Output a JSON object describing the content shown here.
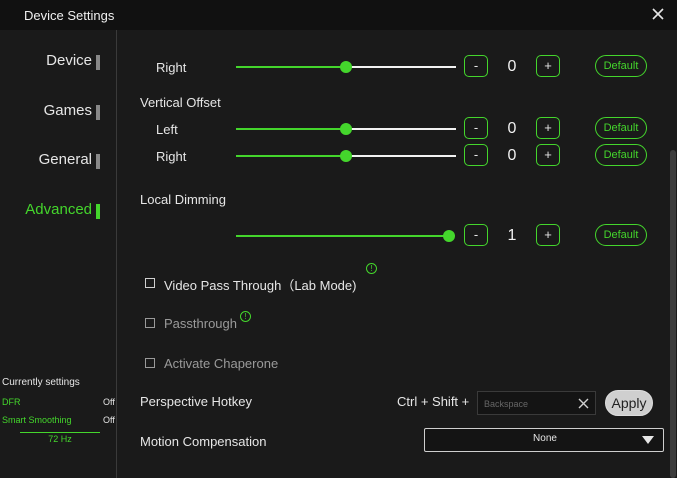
{
  "window": {
    "title": "Device Settings"
  },
  "sidebar": {
    "items": [
      {
        "label": "Device",
        "active": false
      },
      {
        "label": "Games",
        "active": false
      },
      {
        "label": "General",
        "active": false
      },
      {
        "label": "Advanced",
        "active": true
      }
    ]
  },
  "horizontal_offset": {
    "right": {
      "label": "Right",
      "value": "0",
      "level_percent": 50,
      "minus": "-",
      "plus": "+",
      "default_label": "Default"
    }
  },
  "vertical_offset": {
    "heading": "Vertical Offset",
    "left": {
      "label": "Left",
      "value": "0",
      "level_percent": 50,
      "minus": "-",
      "plus": "+",
      "default_label": "Default"
    },
    "right": {
      "label": "Right",
      "value": "0",
      "level_percent": 50,
      "minus": "-",
      "plus": "+",
      "default_label": "Default"
    }
  },
  "local_dimming": {
    "heading": "Local Dimming",
    "value": "1",
    "level_percent": 100,
    "minus": "-",
    "plus": "+",
    "default_label": "Default"
  },
  "options": {
    "video_pass_through": {
      "label": "Video Pass Through（Lab Mode)",
      "checked": false,
      "info": "!"
    },
    "passthrough": {
      "label": "Passthrough",
      "checked": false,
      "enabled": false,
      "info": "!"
    },
    "chaperone": {
      "label": "Activate Chaperone",
      "checked": false,
      "enabled": false
    }
  },
  "hotkey": {
    "label": "Perspective Hotkey",
    "modifiers": "Ctrl + Shift +",
    "placeholder": "Backspace",
    "apply_label": "Apply"
  },
  "motion_compensation": {
    "label": "Motion Compensation",
    "selected": "None"
  },
  "status": {
    "title": "Currently settings",
    "rows": [
      {
        "key": "DFR",
        "value": "Off"
      },
      {
        "key": "Smart Smoothing",
        "value": "Off"
      }
    ],
    "refresh_rate": "72 Hz"
  },
  "colors": {
    "accent": "#44d62c",
    "background": "#1a1a1a",
    "titlebar": "#111111"
  },
  "icons": {
    "close": "close-icon",
    "info": "info-icon",
    "clear": "clear-icon",
    "dropdown": "chevron-down-icon"
  }
}
